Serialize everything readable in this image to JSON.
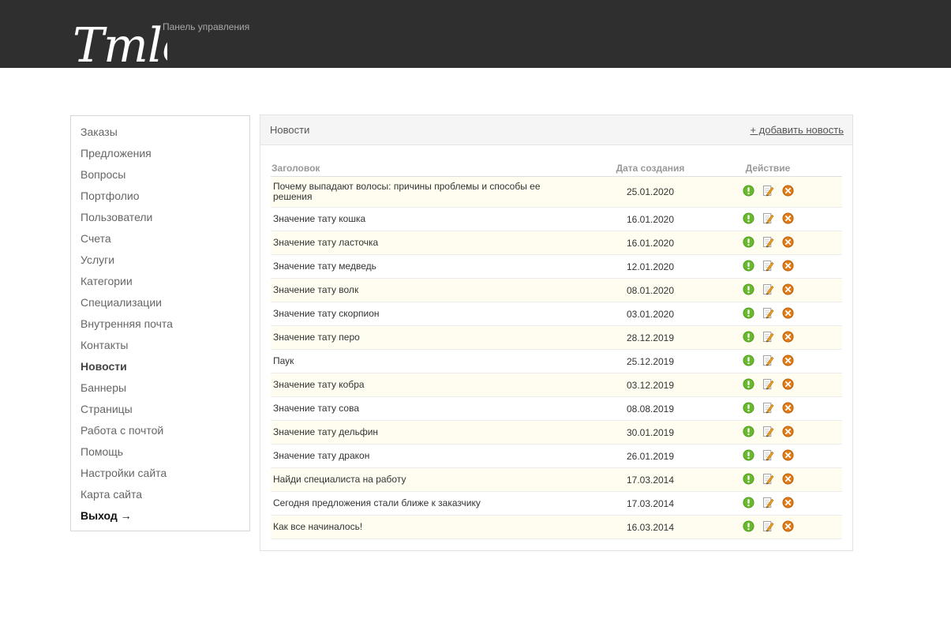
{
  "header": {
    "logo_text": "Tmle",
    "subtitle": "Панель управления"
  },
  "sidebar": {
    "items": [
      {
        "label": "Заказы",
        "state": "normal"
      },
      {
        "label": "Предложения",
        "state": "normal"
      },
      {
        "label": "Вопросы",
        "state": "normal"
      },
      {
        "label": "Портфолио",
        "state": "normal"
      },
      {
        "label": "Пользователи",
        "state": "normal"
      },
      {
        "label": "Счета",
        "state": "normal"
      },
      {
        "label": "Услуги",
        "state": "normal"
      },
      {
        "label": "Категории",
        "state": "normal"
      },
      {
        "label": "Специализации",
        "state": "normal"
      },
      {
        "label": "Внутренняя почта",
        "state": "normal"
      },
      {
        "label": "Контакты",
        "state": "normal"
      },
      {
        "label": "Новости",
        "state": "active"
      },
      {
        "label": "Баннеры",
        "state": "normal"
      },
      {
        "label": "Страницы",
        "state": "normal"
      },
      {
        "label": "Работа с почтой",
        "state": "normal"
      },
      {
        "label": "Помощь",
        "state": "normal"
      },
      {
        "label": "Настройки сайта",
        "state": "normal"
      },
      {
        "label": "Карта сайта",
        "state": "normal"
      },
      {
        "label": "Выход →",
        "state": "logout"
      }
    ]
  },
  "panel": {
    "title": "Новости",
    "add_link": "+ добавить новость"
  },
  "table": {
    "columns": {
      "title": "Заголовок",
      "date": "Дата создания",
      "actions": "Действие"
    },
    "rows": [
      {
        "title": "Почему выпадают волосы: причины проблемы и способы ее решения",
        "date": "25.01.2020"
      },
      {
        "title": "Значение тату кошка",
        "date": "16.01.2020"
      },
      {
        "title": "Значение тату ласточка",
        "date": "16.01.2020"
      },
      {
        "title": "Значение тату медведь",
        "date": "12.01.2020"
      },
      {
        "title": "Значение тату волк",
        "date": "08.01.2020"
      },
      {
        "title": "Значение тату скорпион",
        "date": "03.01.2020"
      },
      {
        "title": "Значение тату перо",
        "date": "28.12.2019"
      },
      {
        "title": "Паук",
        "date": "25.12.2019"
      },
      {
        "title": "Значение тату кобра",
        "date": "03.12.2019"
      },
      {
        "title": "Значение тату сова",
        "date": "08.08.2019"
      },
      {
        "title": "Значение тату дельфин",
        "date": "30.01.2019"
      },
      {
        "title": "Значение тату дракон",
        "date": "26.01.2019"
      },
      {
        "title": "Найди специалиста на работу",
        "date": "17.03.2014"
      },
      {
        "title": "Сегодня предложения стали ближе к заказчику",
        "date": "17.03.2014"
      },
      {
        "title": "Как все начиналось!",
        "date": "16.03.2014"
      }
    ],
    "row_actions": [
      "info-icon",
      "edit-icon",
      "delete-icon"
    ]
  },
  "colors": {
    "topbar": "#2f2f2f",
    "row_highlight": "#fefdf0",
    "info_green": "#6ab82e",
    "delete_orange": "#e07d1a"
  }
}
